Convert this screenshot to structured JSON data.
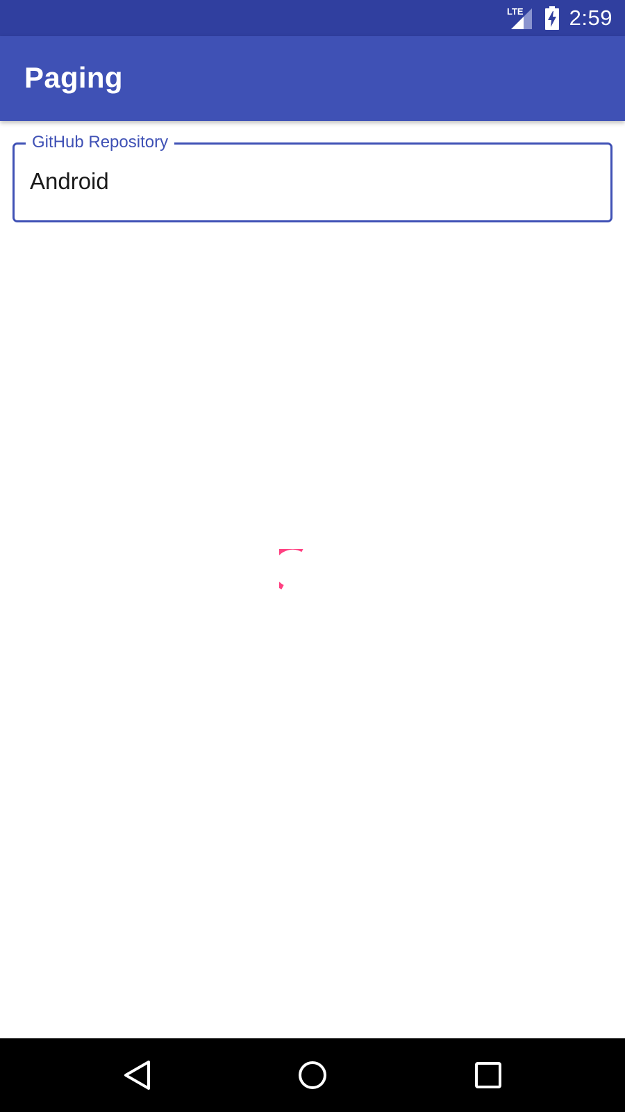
{
  "status_bar": {
    "network_label": "LTE",
    "time": "2:59",
    "icons": [
      "lte-signal-icon",
      "battery-charging-icon"
    ]
  },
  "app_bar": {
    "title": "Paging"
  },
  "search": {
    "label": "GitHub Repository",
    "value": "Android"
  },
  "loading": {
    "icon": "loading-spinner-icon",
    "color": "#ff4081"
  },
  "nav_bar": {
    "icons": [
      "back-icon",
      "home-icon",
      "recents-icon"
    ]
  },
  "colors": {
    "primary": "#3f51b5",
    "primary_dark": "#303f9f",
    "accent": "#ff4081"
  }
}
